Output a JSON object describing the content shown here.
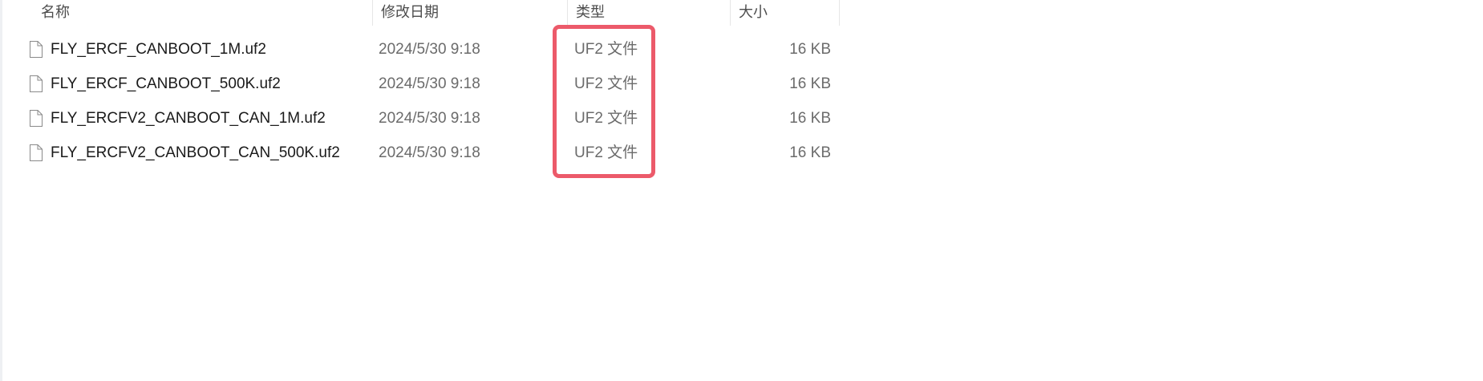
{
  "columns": {
    "name": "名称",
    "date": "修改日期",
    "type": "类型",
    "size": "大小"
  },
  "files": [
    {
      "name": "FLY_ERCF_CANBOOT_1M.uf2",
      "date": "2024/5/30 9:18",
      "type": "UF2 文件",
      "size": "16 KB",
      "icon": "file-icon"
    },
    {
      "name": "FLY_ERCF_CANBOOT_500K.uf2",
      "date": "2024/5/30 9:18",
      "type": "UF2 文件",
      "size": "16 KB",
      "icon": "file-icon"
    },
    {
      "name": "FLY_ERCFV2_CANBOOT_CAN_1M.uf2",
      "date": "2024/5/30 9:18",
      "type": "UF2 文件",
      "size": "16 KB",
      "icon": "file-icon"
    },
    {
      "name": "FLY_ERCFV2_CANBOOT_CAN_500K.uf2",
      "date": "2024/5/30 9:18",
      "type": "UF2 文件",
      "size": "16 KB",
      "icon": "file-icon"
    }
  ],
  "colors": {
    "highlight": "#ec5a6a",
    "secondary_text": "#6b6b6b"
  }
}
